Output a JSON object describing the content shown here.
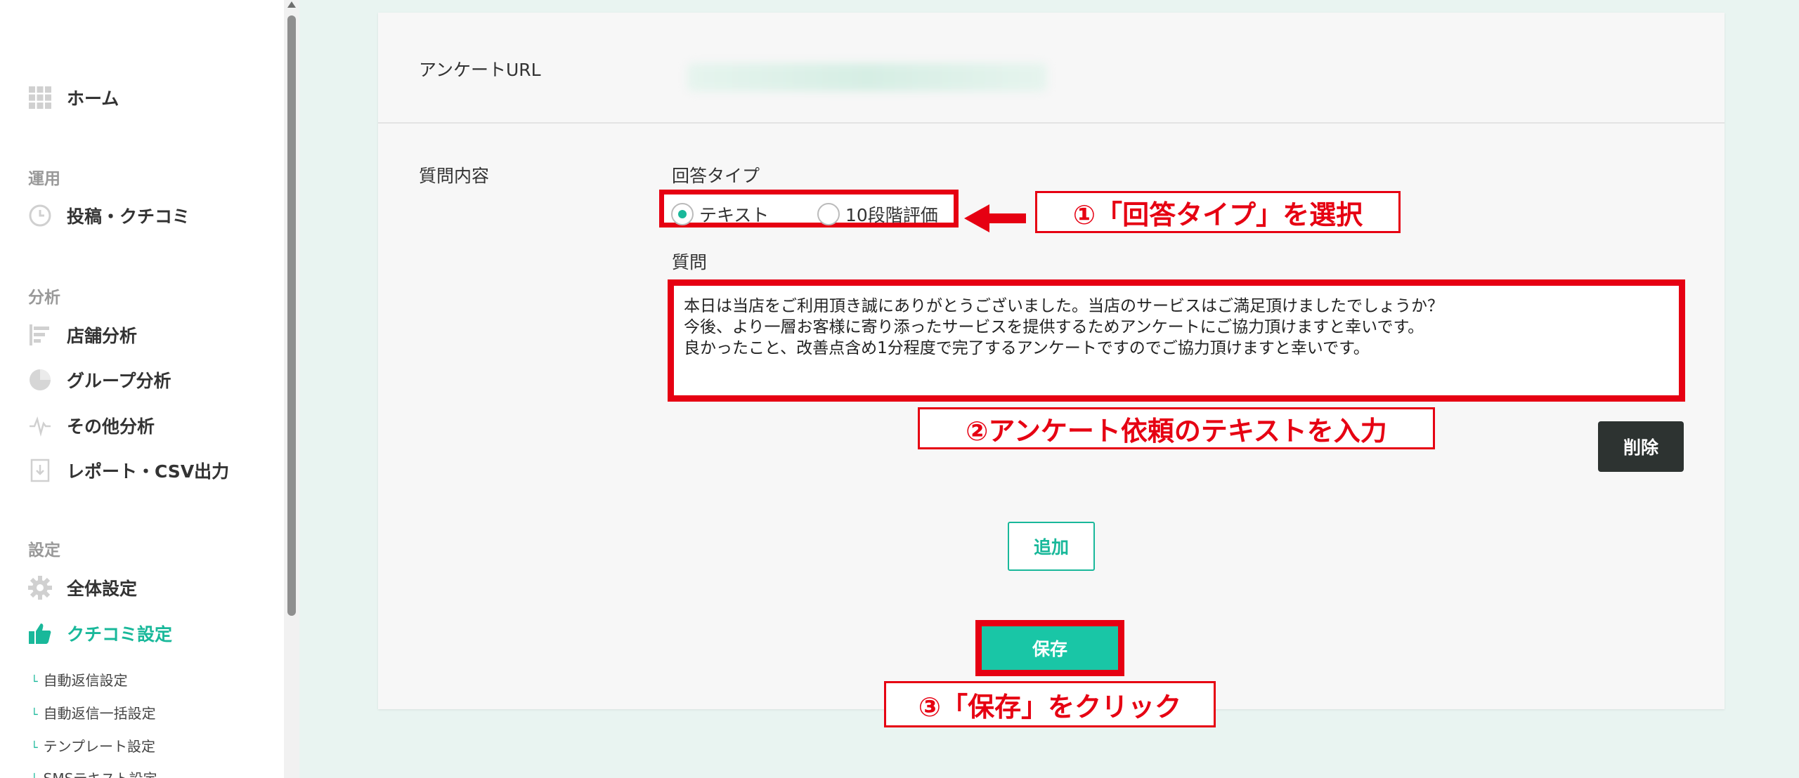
{
  "sidebar": {
    "home_label": "ホーム",
    "section_operation": "運用",
    "posts_label": "投稿・クチコミ",
    "section_analysis": "分析",
    "store_analysis_label": "店舗分析",
    "group_analysis_label": "グループ分析",
    "other_analysis_label": "その他分析",
    "report_label": "レポート・CSV出力",
    "section_settings": "設定",
    "general_settings_label": "全体設定",
    "review_settings_label": "クチコミ設定",
    "sub_items": [
      "自動返信設定",
      "自動返信一括設定",
      "テンプレート設定",
      "SMSテキスト設定"
    ]
  },
  "form": {
    "survey_url_label": "アンケートURL",
    "question_content_label": "質問内容",
    "answer_type_label": "回答タイプ",
    "option_text": "テキスト",
    "option_scale": "10段階評価",
    "question_label": "質問",
    "question_lines": [
      "本日は当店をご利用頂き誠にありがとうございました。当店のサービスはご満足頂けましたでしょうか？",
      "今後、より一層お客様に寄り添ったサービスを提供するためアンケートにご協力頂けますと幸いです。",
      "良かったこと、改善点含め1分程度で完了するアンケートですのでご協力頂けますと幸いです。"
    ],
    "delete_label": "削除",
    "add_label": "追加",
    "save_label": "保存",
    "selected_option": "テキスト"
  },
  "callouts": {
    "step1": "①「回答タイプ」を選択",
    "step2": "②アンケート依頼のテキストを入力",
    "step3": "③「保存」をクリック"
  },
  "colors": {
    "accent": "#19b89a",
    "annotation_red": "#e60012",
    "background": "#e9f4f1"
  }
}
